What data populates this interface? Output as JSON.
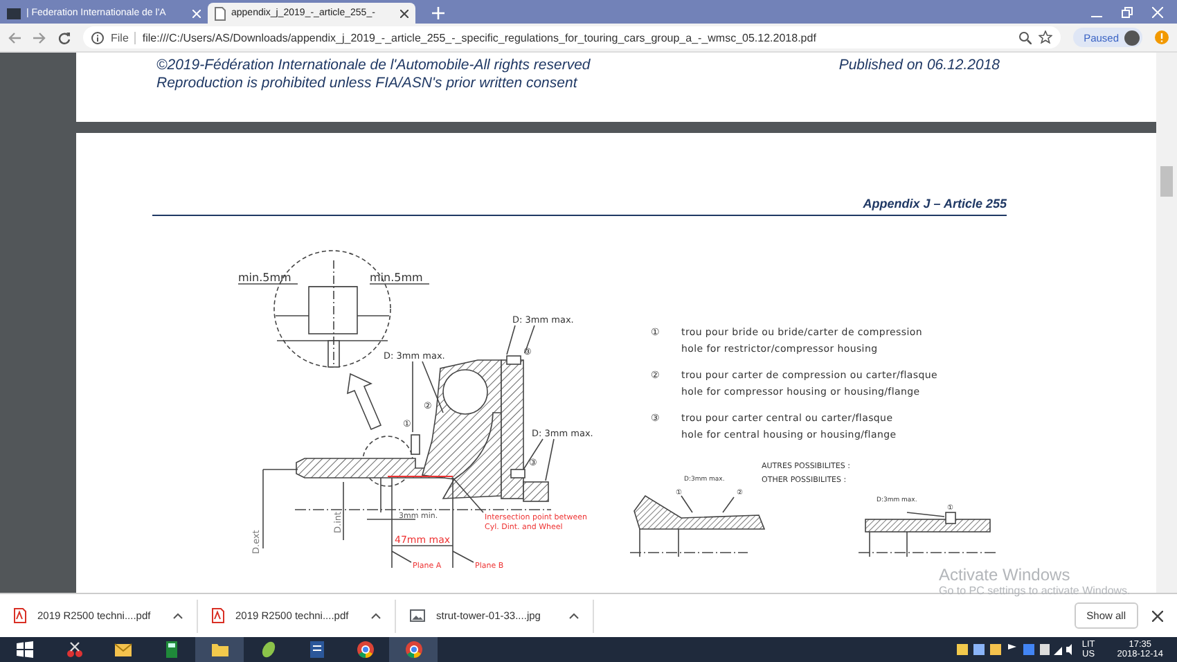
{
  "browser": {
    "tabs": [
      {
        "title": "| Federation Internationale de l'A",
        "selected": false,
        "kind": "site"
      },
      {
        "title": "appendix_j_2019_-_article_255_-",
        "selected": true,
        "kind": "document"
      }
    ],
    "address": {
      "scheme_label": "File",
      "url": "file:///C:/Users/AS/Downloads/appendix_j_2019_-_article_255_-_specific_regulations_for_touring_cars_group_a_-_wmsc_05.12.2018.pdf"
    },
    "profile": {
      "label": "Paused"
    }
  },
  "page1": {
    "copyright": "©2019-Fédération Internationale de l'Automobile-All rights reserved",
    "notice": "Reproduction is prohibited unless FIA/ASN's prior written consent",
    "published": "Published on 06.12.2018"
  },
  "page2": {
    "header": "Appendix J – Article 255",
    "figure": {
      "detail_labels": [
        "min.5mm",
        "min.5mm"
      ],
      "hole_labels": [
        "D: 3mm max.",
        "D: 3mm max.",
        "D: 3mm max."
      ],
      "markers": [
        "①",
        "②",
        "③",
        "③"
      ],
      "gap_label": "3mm min.",
      "intersection_note": [
        "Intersection point between",
        "Cyl. Dint. and Wheel"
      ],
      "length_label": "47mm max",
      "plane_labels": [
        "Plane A",
        "Plane B"
      ],
      "diameter_labels": [
        "D.ext",
        "D.int"
      ]
    },
    "legend": [
      {
        "marker": "①",
        "fr": "trou pour bride ou bride/carter de compression",
        "en": "hole for restrictor/compressor housing"
      },
      {
        "marker": "②",
        "fr": "trou pour carter de compression ou carter/flasque",
        "en": "hole for compressor housing or housing/flange"
      },
      {
        "marker": "③",
        "fr": "trou pour carter central ou carter/flasque",
        "en": "hole for central housing or housing/flange"
      }
    ],
    "alternatives": {
      "headings": [
        "AUTRES POSSIBILITES :",
        "OTHER POSSIBILITES :"
      ],
      "left_labels": [
        "D:3mm max.",
        "①",
        "②"
      ],
      "right_labels": [
        "D:3mm max.",
        "①"
      ]
    }
  },
  "downloads": {
    "items": [
      {
        "name": "2019 R2500 techni....pdf",
        "kind": "pdf"
      },
      {
        "name": "2019 R2500 techni....pdf",
        "kind": "pdf"
      },
      {
        "name": "strut-tower-01-33....jpg",
        "kind": "image"
      }
    ],
    "show_all": "Show all"
  },
  "activation": {
    "title": "Activate Windows",
    "hint": "Go to PC settings to activate Windows."
  },
  "taskbar": {
    "apps": [
      {
        "active": false
      },
      {
        "active": false
      },
      {
        "active": false
      },
      {
        "active": true
      },
      {
        "active": false
      },
      {
        "active": false
      },
      {
        "active": false
      },
      {
        "active": true
      }
    ],
    "language": [
      "LIT",
      "US"
    ],
    "time": "17:35",
    "date": "2018-12-14"
  }
}
